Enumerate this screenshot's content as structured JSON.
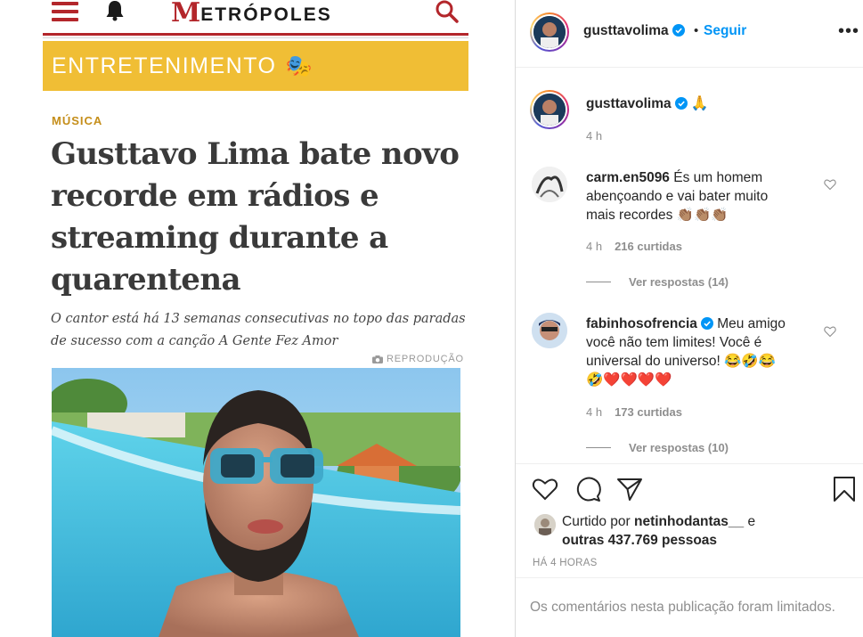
{
  "article": {
    "site_logo_initial": "M",
    "site_logo_rest": "ETRÓPOLES",
    "section": "ENTRETENIMENTO",
    "section_emoji": "🎭",
    "kicker": "MÚSICA",
    "headline": "Gusttavo Lima bate novo recorde em rádios e streaming durante a quarentena",
    "subhead": "O cantor está há 13 semanas consecutivas no topo das paradas de sucesso com a canção A Gente Fez Amor",
    "photo_credit": "REPRODUÇÃO"
  },
  "post": {
    "author": "gusttavolima",
    "separator": "•",
    "follow_label": "Seguir",
    "more_label": "•••",
    "caption_emoji": "🙏",
    "caption_time": "4 h",
    "comments": [
      {
        "username": "carm.en5096",
        "text": "És um homem abençoando e vai bater muito mais recordes 👏🏽👏🏽👏🏽",
        "time": "4 h",
        "likes": "216 curtidas",
        "replies": "Ver respostas (14)"
      },
      {
        "username": "fabinhosofrencia",
        "text_line1": "Meu amigo",
        "text_line2": "você não tem limites! Você é",
        "text_line3": "universal do universo! 😂🤣😂",
        "text_line4": "🤣❤️❤️❤️❤️",
        "time": "4 h",
        "likes": "173 curtidas",
        "replies": "Ver respostas (10)"
      }
    ],
    "liked_by_prefix": "Curtido por",
    "liked_by_user": "netinhodantas__",
    "liked_by_and": "e",
    "liked_by_others": "outras 437.769 pessoas",
    "posted_ago": "HÁ 4 HORAS",
    "comments_limited": "Os comentários nesta publicação foram limitados."
  },
  "colors": {
    "brand_red": "#b3262b",
    "section_yellow": "#f0be35",
    "kicker_gold": "#c58e1a",
    "ig_blue": "#0095f6",
    "ig_text": "#262626",
    "ig_muted": "#8e8e8e"
  },
  "icons": [
    "hamburger-icon",
    "bell-icon",
    "search-icon",
    "camera-icon",
    "verified-icon",
    "heart-icon",
    "comment-icon",
    "share-icon",
    "bookmark-icon"
  ]
}
